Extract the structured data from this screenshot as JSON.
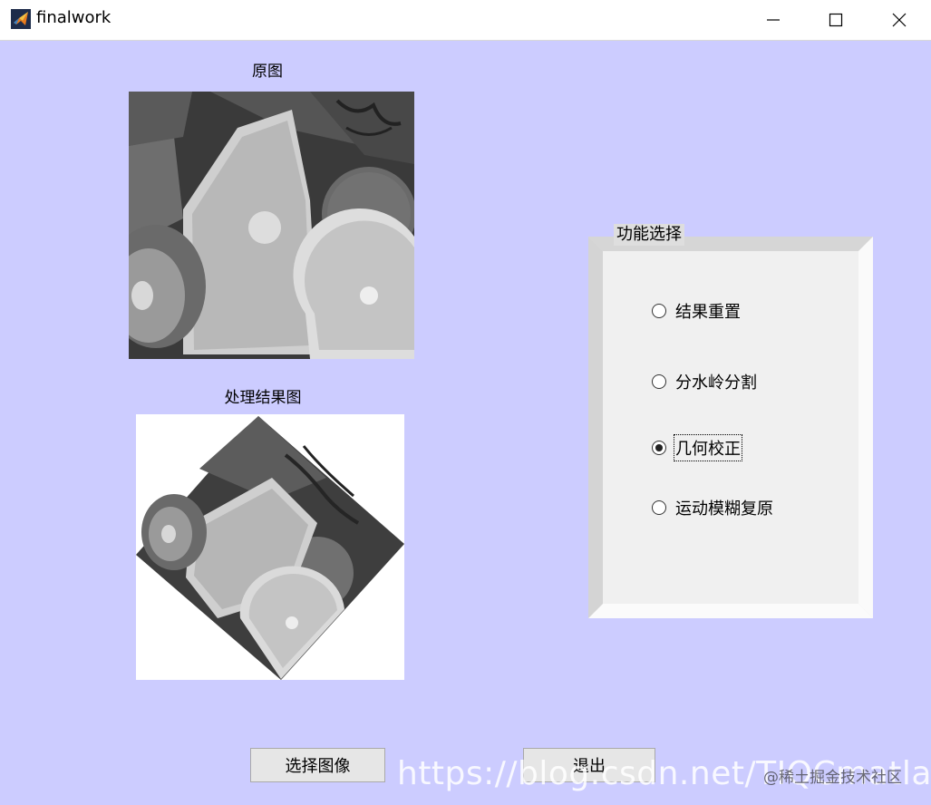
{
  "window": {
    "title": "finalwork",
    "controls": {
      "minimize": "minimize-icon",
      "maximize": "maximize-icon",
      "close": "close-icon"
    }
  },
  "original_image": {
    "caption": "原图",
    "content": "grayscale fruit photo (orange, kiwi, lemon)"
  },
  "result_image": {
    "caption": "处理结果图",
    "content": "rotated grayscale fruit photo"
  },
  "function_panel": {
    "title": "功能选择",
    "options": [
      {
        "label": "结果重置",
        "selected": false
      },
      {
        "label": "分水岭分割",
        "selected": false
      },
      {
        "label": "几何校正",
        "selected": true
      },
      {
        "label": "运动模糊复原",
        "selected": false
      }
    ]
  },
  "buttons": {
    "select_image": "选择图像",
    "exit": "退出"
  },
  "watermark": {
    "url": "https://blog.csdn.net/TIQCmatlab",
    "credit": "@稀土掘金技术社区"
  },
  "colors": {
    "background": "#ccccff",
    "panel": "#f0f0f0",
    "titlebar": "#ffffff"
  }
}
